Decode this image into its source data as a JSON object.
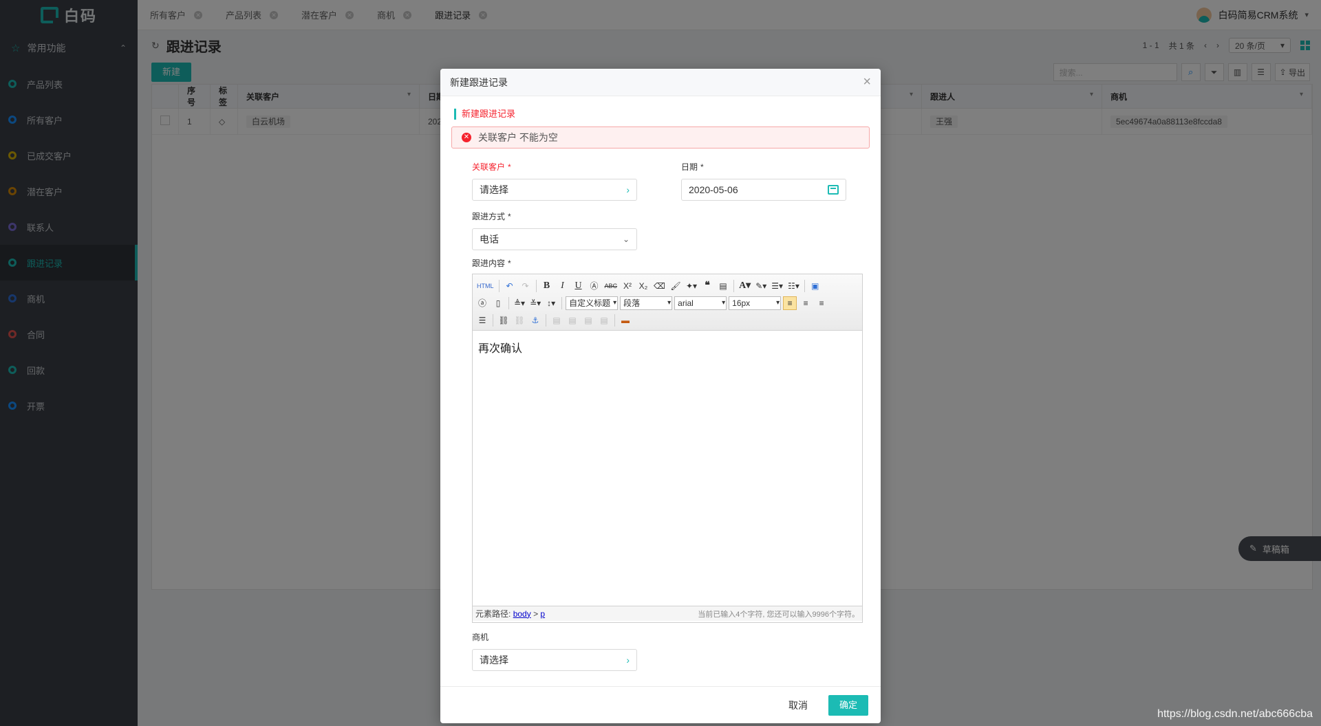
{
  "app": {
    "logo_text": "白码"
  },
  "sidebar": {
    "group_label": "常用功能",
    "items": [
      {
        "label": "产品列表",
        "color": "#1cbbb4"
      },
      {
        "label": "所有客户",
        "color": "#1890ff"
      },
      {
        "label": "已成交客户",
        "color": "#d4b106"
      },
      {
        "label": "潜在客户",
        "color": "#d48806"
      },
      {
        "label": "联系人",
        "color": "#7b6cd6"
      },
      {
        "label": "跟进记录",
        "color": "#1cbbb4"
      },
      {
        "label": "商机",
        "color": "#2f6fd6"
      },
      {
        "label": "合同",
        "color": "#e0524f"
      },
      {
        "label": "回款",
        "color": "#1cbbb4"
      },
      {
        "label": "开票",
        "color": "#1890ff"
      }
    ]
  },
  "tabs": [
    "所有客户",
    "产品列表",
    "潜在客户",
    "商机",
    "跟进记录"
  ],
  "user": {
    "name": "白码简易CRM系统"
  },
  "page": {
    "title": "跟进记录",
    "pager_range": "1 - 1",
    "pager_total": "共 1 条",
    "per_page": "20 条/页",
    "new_button": "新建",
    "search_placeholder": "搜索...",
    "export_label": "导出"
  },
  "table": {
    "headers": [
      "序号",
      "标签",
      "关联客户",
      "日期",
      "跟进人",
      "商机"
    ],
    "rows": [
      {
        "index": "1",
        "customer": "白云机场",
        "date": "2020-",
        "follower": "王强",
        "opportunity": "5ec49674a0a88113e8fccda8"
      }
    ]
  },
  "draft_box": "草稿箱",
  "watermark": "https://blog.csdn.net/abc666cba",
  "modal": {
    "title": "新建跟进记录",
    "section_title": "新建跟进记录",
    "alert": "关联客户 不能为空",
    "fields": {
      "customer_label": "关联客户",
      "customer_value": "请选择",
      "date_label": "日期",
      "date_value": "2020-05-06",
      "method_label": "跟进方式",
      "method_value": "电话",
      "content_label": "跟进内容",
      "opportunity_label": "商机",
      "opportunity_value": "请选择",
      "required_mark": "*"
    },
    "editor": {
      "content": "再次确认",
      "custom_heading": "自定义标题",
      "paragraph": "段落",
      "font": "arial",
      "size": "16px",
      "path_label": "元素路径:",
      "path_body": "body",
      "path_sep": ">",
      "path_p": "p",
      "count_text": "当前已输入4个字符, 您还可以输入9996个字符。"
    },
    "cancel": "取消",
    "confirm": "确定"
  }
}
